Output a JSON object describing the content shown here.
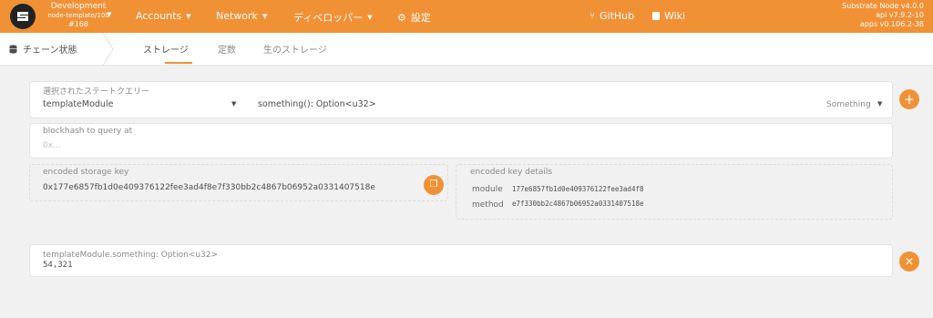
{
  "topbar": {
    "chain_name": "Development",
    "chain_sub": "node-template/100",
    "block": "#168",
    "nav": [
      {
        "label": "Accounts"
      },
      {
        "label": "Network"
      },
      {
        "label": "ディベロッパー"
      },
      {
        "label": "設定"
      }
    ],
    "github": "GitHub",
    "wiki": "Wiki",
    "version": {
      "node": "Substrate Node v4.0.0",
      "api": "api v7.9.2-10",
      "apps": "apps v0.106.2-38"
    }
  },
  "subnav": {
    "section": "チェーン状態",
    "tabs": [
      "ストレージ",
      "定数",
      "生のストレージ"
    ]
  },
  "query": {
    "label": "選択されたステートクエリー",
    "module": "templateModule",
    "method": "something(): Option<u32>",
    "method_hint": "Something"
  },
  "blockhash": {
    "label": "blockhash to query at",
    "placeholder": "0x..."
  },
  "encoded": {
    "label": "encoded storage key",
    "value": "0x177e6857fb1d0e409376122fee3ad4f8e7f330bb2c4867b06952a0331407518e"
  },
  "key_details": {
    "label": "encoded key details",
    "module_label": "module",
    "module_value": "177e6857fb1d0e409376122fee3ad4f8",
    "method_label": "method",
    "method_value": "e7f330bb2c4867b06952a0331407518e"
  },
  "result": {
    "label": "templateModule.something: Option<u32>",
    "value": "54,321"
  },
  "colors": {
    "accent": "#f19135",
    "background": "#f1f1f1"
  }
}
